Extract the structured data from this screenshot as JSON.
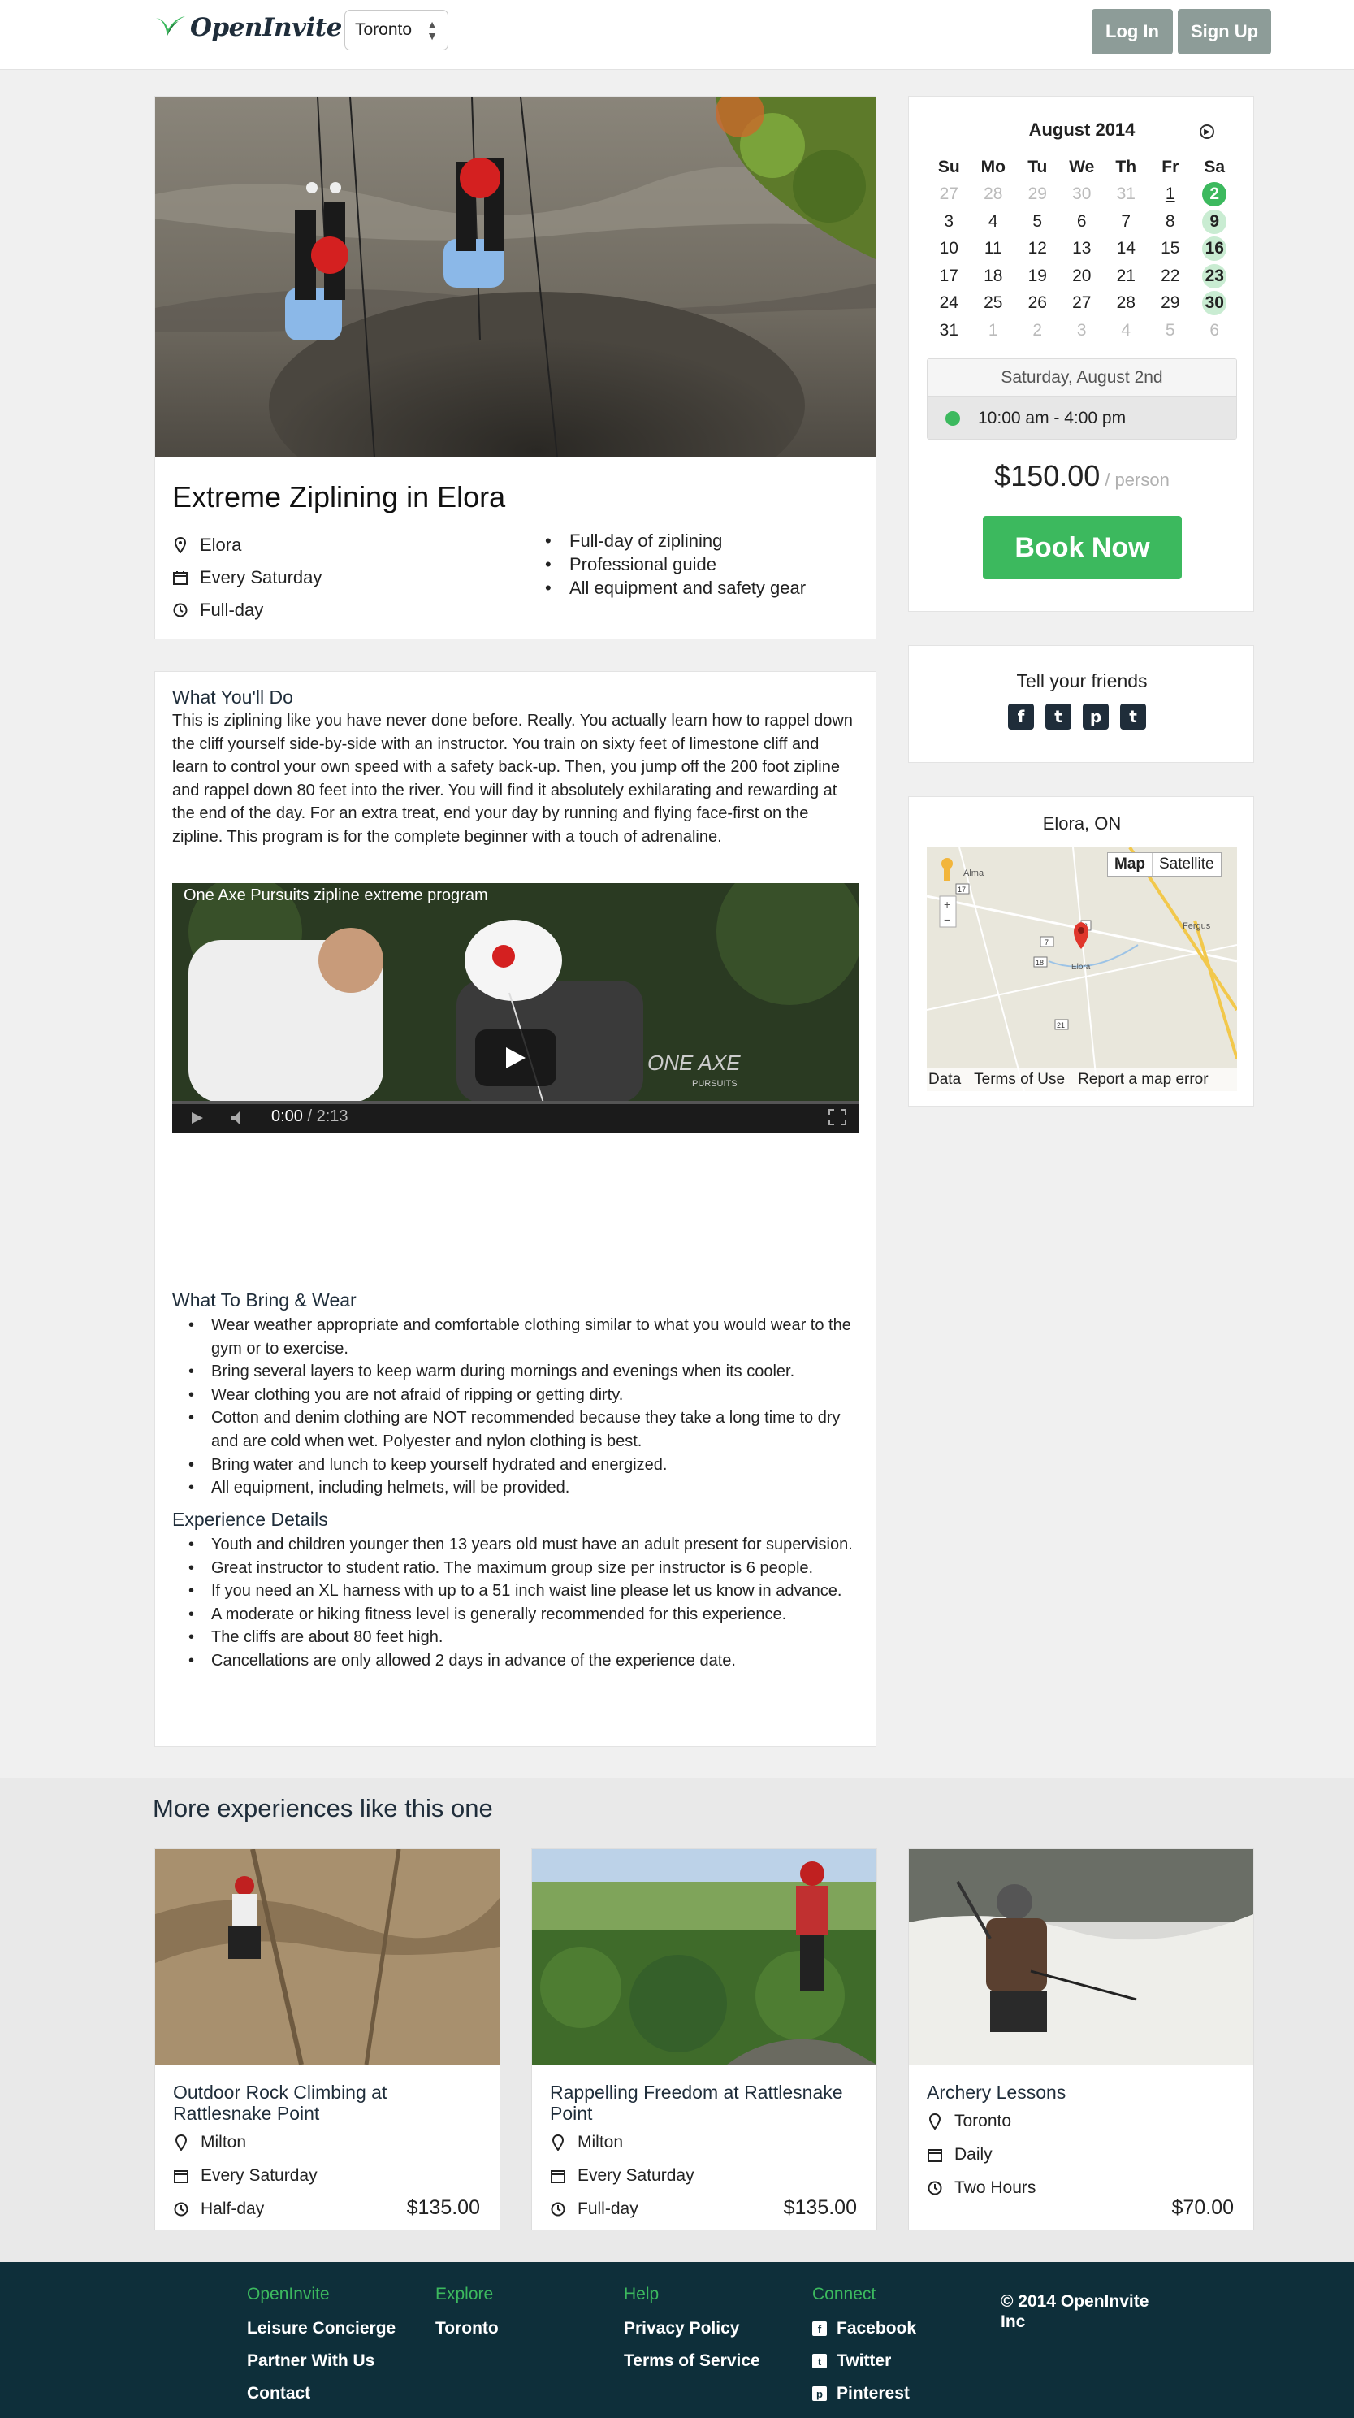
{
  "header": {
    "brand": "OpenInvite",
    "city_selected": "Toronto",
    "login_label": "Log In",
    "signup_label": "Sign Up"
  },
  "experience": {
    "title": "Extreme Ziplining in Elora",
    "location": "Elora",
    "schedule": "Every Saturday",
    "duration": "Full-day",
    "highlights": [
      "Full-day of ziplining",
      "Professional guide",
      "All equipment and safety gear"
    ]
  },
  "calendar": {
    "month_label": "August 2014",
    "weekdays": [
      "Su",
      "Mo",
      "Tu",
      "We",
      "Th",
      "Fr",
      "Sa"
    ],
    "weeks": [
      [
        "27",
        "28",
        "29",
        "30",
        "31",
        "1",
        "2"
      ],
      [
        "3",
        "4",
        "5",
        "6",
        "7",
        "8",
        "9"
      ],
      [
        "10",
        "11",
        "12",
        "13",
        "14",
        "15",
        "16"
      ],
      [
        "17",
        "18",
        "19",
        "20",
        "21",
        "22",
        "23"
      ],
      [
        "24",
        "25",
        "26",
        "27",
        "28",
        "29",
        "30"
      ],
      [
        "31",
        "1",
        "2",
        "3",
        "4",
        "5",
        "6"
      ]
    ],
    "selected_date": "Saturday, August 2nd",
    "time_slot": "10:00 am - 4:00 pm",
    "price": "$150.00",
    "price_unit": "/ person",
    "book_label": "Book Now"
  },
  "share": {
    "title": "Tell your friends",
    "icons": [
      "facebook-icon",
      "twitter-icon",
      "pinterest-icon",
      "tumblr-icon"
    ]
  },
  "map": {
    "title": "Elora, ON",
    "map_label": "Map",
    "satellite_label": "Satellite",
    "footer_data": "Data",
    "footer_terms": "Terms of Use",
    "footer_report": "Report a map error",
    "place_labels": [
      "Alma",
      "Fergus",
      "Elora"
    ],
    "road_labels": [
      "17",
      "7",
      "18",
      "6",
      "21"
    ]
  },
  "description": {
    "what_title": "What You'll Do",
    "what_text": "This is ziplining like you have never done before. Really. You actually learn how to rappel down the cliff yourself side-by-side with an instructor. You train on sixty feet of limestone cliff and learn to control your own speed with a safety back-up. Then, you jump off the 200 foot zipline and rappel down 80 feet into the river. You will find it absolutely exhilarating and rewarding at the end of the day. For an extra treat, end your day by running and flying face-first on the zipline. This program is for the complete beginner with a touch of adrenaline.",
    "video_title": "One Axe Pursuits zipline extreme program",
    "video_current": "0:00",
    "video_duration": "/ 2:13",
    "video_watermark_1": "ONE AXE",
    "video_watermark_2": "PURSUITS",
    "bring_title": "What To Bring & Wear",
    "bring_items": [
      "Wear weather appropriate and comfortable clothing similar to what you would wear to the gym or to exercise.",
      "Bring several layers to keep warm during mornings and evenings when its cooler.",
      "Wear clothing you are not afraid of ripping or getting dirty.",
      "Cotton and denim clothing are NOT recommended because they take a long time to dry and are cold when wet. Polyester and nylon clothing is best.",
      "Bring water and lunch to keep yourself hydrated and energized.",
      "All equipment, including helmets, will be provided."
    ],
    "details_title": "Experience Details",
    "details_items": [
      "Youth and children younger then 13 years old must have an adult present for supervision.",
      "Great instructor to student ratio. The maximum group size per instructor is 6 people.",
      "If you need an XL harness with up to a 51 inch waist line please let us know in advance.",
      "A moderate or hiking fitness level is generally recommended for this experience.",
      "The cliffs are about 80 feet high.",
      "Cancellations are only allowed 2 days in advance of the experience date."
    ]
  },
  "related": {
    "title": "More experiences like this one",
    "items": [
      {
        "title": "Outdoor Rock Climbing at Rattlesnake Point",
        "location": "Milton",
        "schedule": "Every Saturday",
        "duration": "Half-day",
        "price": "$135.00"
      },
      {
        "title": "Rappelling Freedom at Rattlesnake Point",
        "location": "Milton",
        "schedule": "Every Saturday",
        "duration": "Full-day",
        "price": "$135.00"
      },
      {
        "title": "Archery Lessons",
        "location": "Toronto",
        "schedule": "Daily",
        "duration": "Two Hours",
        "price": "$70.00"
      }
    ]
  },
  "footer": {
    "col1_head": "OpenInvite",
    "col1_links": [
      "Leisure Concierge",
      "Partner With Us",
      "Contact"
    ],
    "col2_head": "Explore",
    "col2_links": [
      "Toronto"
    ],
    "col3_head": "Help",
    "col3_links": [
      "Privacy Policy",
      "Terms of Service"
    ],
    "col4_head": "Connect",
    "col4_links": [
      "Facebook",
      "Twitter",
      "Pinterest"
    ],
    "copyright": "© 2014 OpenInvite Inc"
  },
  "colors": {
    "accent_green": "#3cb95e",
    "available_day": "#c9ecd2",
    "footer_bg": "#0e2f3a",
    "auth_button": "#8d9c98"
  }
}
